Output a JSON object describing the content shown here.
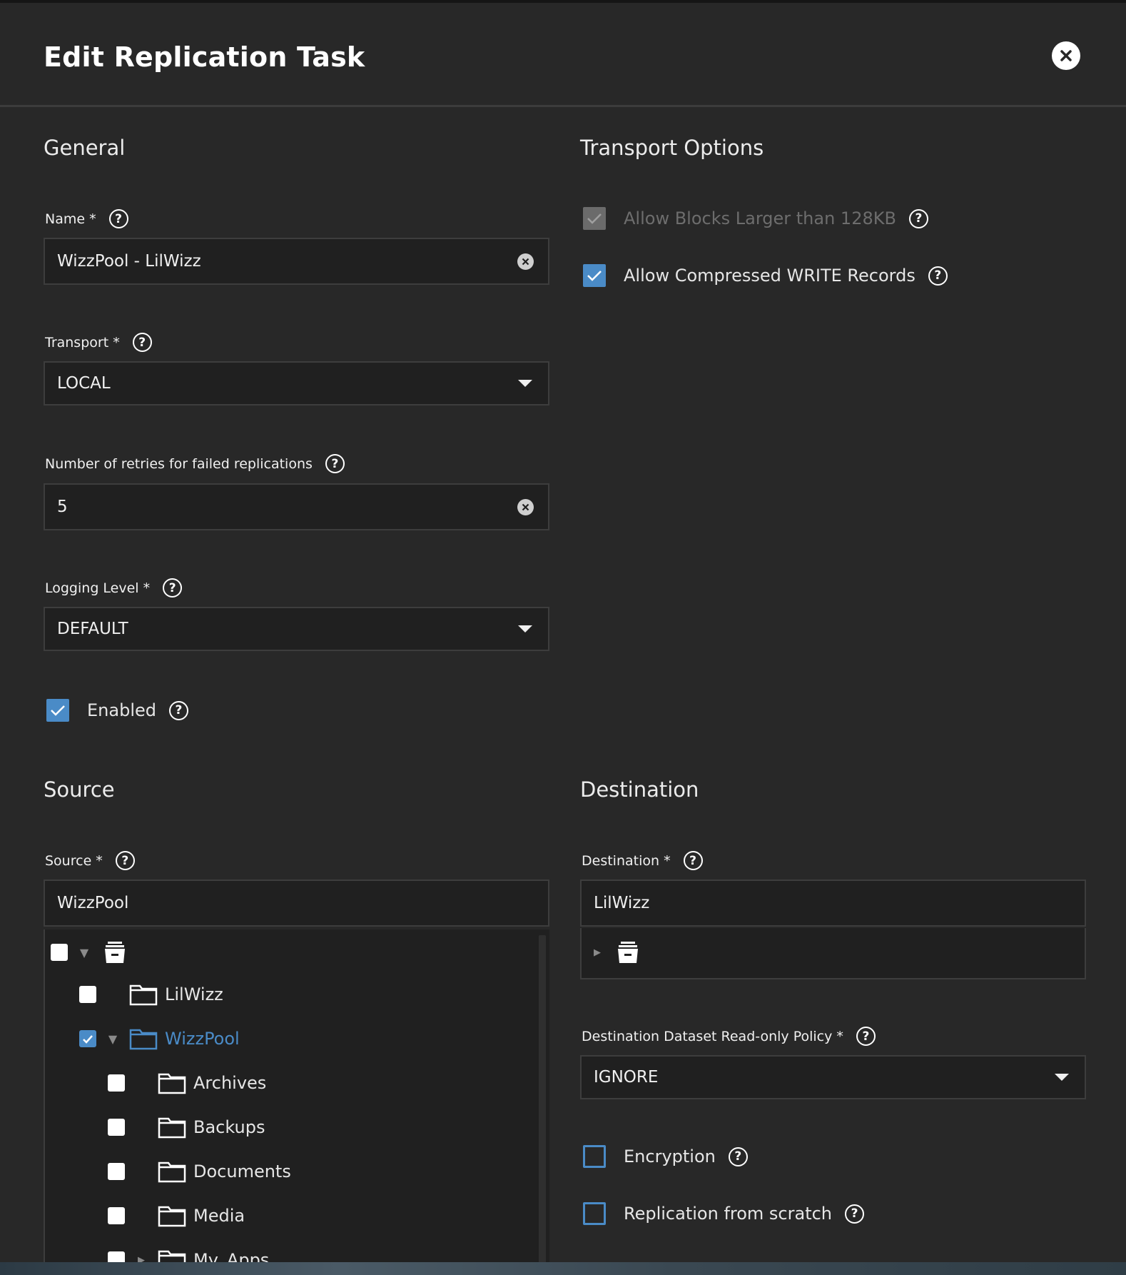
{
  "dialog": {
    "title": "Edit Replication Task"
  },
  "general": {
    "section_title": "General",
    "name": {
      "label": "Name *",
      "value": "WizzPool - LilWizz"
    },
    "transport": {
      "label": "Transport *",
      "value": "LOCAL"
    },
    "retries": {
      "label": "Number of retries for failed replications",
      "value": "5"
    },
    "logging": {
      "label": "Logging Level *",
      "value": "DEFAULT"
    },
    "enabled": {
      "label": "Enabled",
      "checked": true
    }
  },
  "transport_options": {
    "section_title": "Transport Options",
    "large_blocks": {
      "label": "Allow Blocks Larger than 128KB",
      "checked": true,
      "disabled": true
    },
    "compressed": {
      "label": "Allow Compressed WRITE Records",
      "checked": true
    }
  },
  "source": {
    "section_title": "Source",
    "label": "Source *",
    "value": "WizzPool",
    "tree": {
      "root_expanded": true,
      "lilwizz": "LilWizz",
      "wizzpool": "WizzPool",
      "children": [
        "Archives",
        "Backups",
        "Documents",
        "Media",
        "My_Apps"
      ]
    }
  },
  "destination": {
    "section_title": "Destination",
    "label": "Destination *",
    "value": "LilWizz",
    "readonly_policy": {
      "label": "Destination Dataset Read-only Policy *",
      "value": "IGNORE"
    },
    "encryption": {
      "label": "Encryption",
      "checked": false
    },
    "from_scratch": {
      "label": "Replication from scratch",
      "checked": false
    }
  },
  "colors": {
    "background": "#282828",
    "field": "#202020",
    "accent": "#4a8bc7"
  }
}
